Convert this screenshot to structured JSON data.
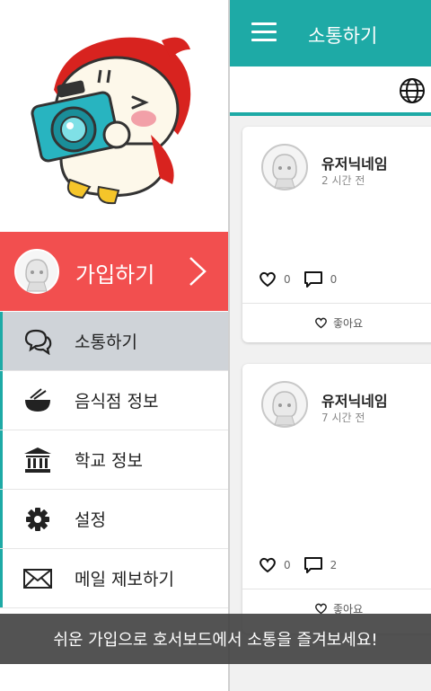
{
  "app": {
    "title": "소통하기",
    "accent_color": "#1eaaa6",
    "join_color": "#f24f4f"
  },
  "drawer": {
    "join_label": "가입하기",
    "items": [
      {
        "label": "소통하기",
        "icon": "chat-bubbles-icon",
        "active": true
      },
      {
        "label": "음식점 정보",
        "icon": "food-bowl-icon",
        "active": false
      },
      {
        "label": "학교 정보",
        "icon": "school-building-icon",
        "active": false
      },
      {
        "label": "설정",
        "icon": "gear-icon",
        "active": false
      },
      {
        "label": "메일 제보하기",
        "icon": "mail-icon",
        "active": false
      }
    ]
  },
  "feed": {
    "posts": [
      {
        "user": "유저닉네임",
        "time": "2 시간 전",
        "likes": "0",
        "comments": "0",
        "like_label": "좋아요"
      },
      {
        "user": "유저닉네임",
        "time": "7 시간 전",
        "likes": "0",
        "comments": "2",
        "like_label": "좋아요"
      }
    ]
  },
  "toast": "쉬운 가입으로 호서보드에서 소통을 즐겨보세요!"
}
